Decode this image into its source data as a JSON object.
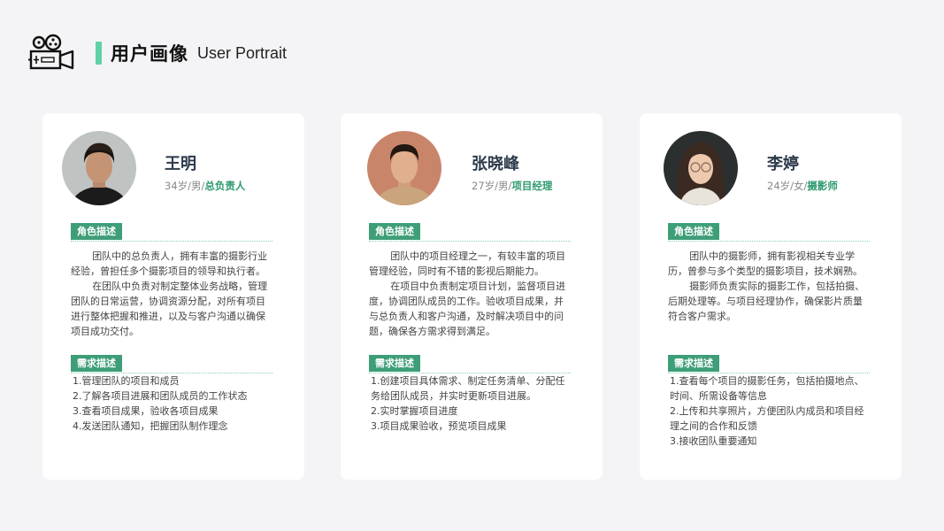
{
  "header": {
    "title_cn": "用户画像",
    "title_en": "User Portrait",
    "icon": "film-camera-icon",
    "accent_color": "#5fd1a8"
  },
  "personas": [
    {
      "name": "王明",
      "age_gender": "34岁/男/",
      "role": "总负责人",
      "role_label": "角色描述",
      "role_paragraphs": [
        "团队中的总负责人，拥有丰富的摄影行业经验，曾担任多个摄影项目的领导和执行者。",
        "在团队中负责对制定整体业务战略，管理团队的日常运营，协调资源分配，对所有项目进行整体把握和推进，以及与客户沟通以确保项目成功交付。"
      ],
      "needs_label": "需求描述",
      "needs": [
        "1.管理团队的项目和成员",
        "2.了解各项目进展和团队成员的工作状态",
        "3.查看项目成果，验收各项目成果",
        "4.发送团队通知，把握团队制作理念"
      ]
    },
    {
      "name": "张晓峰",
      "age_gender": "27岁/男/",
      "role": "项目经理",
      "role_label": "角色描述",
      "role_paragraphs": [
        "团队中的项目经理之一，有较丰富的项目管理经验，同时有不错的影视后期能力。",
        "在项目中负责制定项目计划，监督项目进度，协调团队成员的工作。验收项目成果，并与总负责人和客户沟通，及时解决项目中的问题，确保各方需求得到满足。"
      ],
      "needs_label": "需求描述",
      "needs": [
        "1.创建项目具体需求、制定任务清单、分配任务给团队成员，并实时更新项目进展。",
        "2.实时掌握项目进度",
        "3.项目成果验收，预览项目成果"
      ]
    },
    {
      "name": "李婷",
      "age_gender": "24岁/女/",
      "role": "摄影师",
      "role_label": "角色描述",
      "role_paragraphs": [
        "团队中的摄影师，拥有影视相关专业学历，曾参与多个类型的摄影项目，技术娴熟。",
        "摄影师负责实际的摄影工作，包括拍摄、后期处理等。与项目经理协作，确保影片质量符合客户需求。"
      ],
      "needs_label": "需求描述",
      "needs": [
        "1.查看每个项目的摄影任务，包括拍摄地点、时间、所需设备等信息",
        "2.上传和共享照片，方便团队内成员和项目经理之间的合作和反馈",
        "3.接收团队重要通知"
      ]
    }
  ],
  "colors": {
    "background": "#f4f4f6",
    "card": "#ffffff",
    "tag": "#3e9e78",
    "role_text": "#2d9a6d",
    "name_text": "#2d3a4a"
  }
}
